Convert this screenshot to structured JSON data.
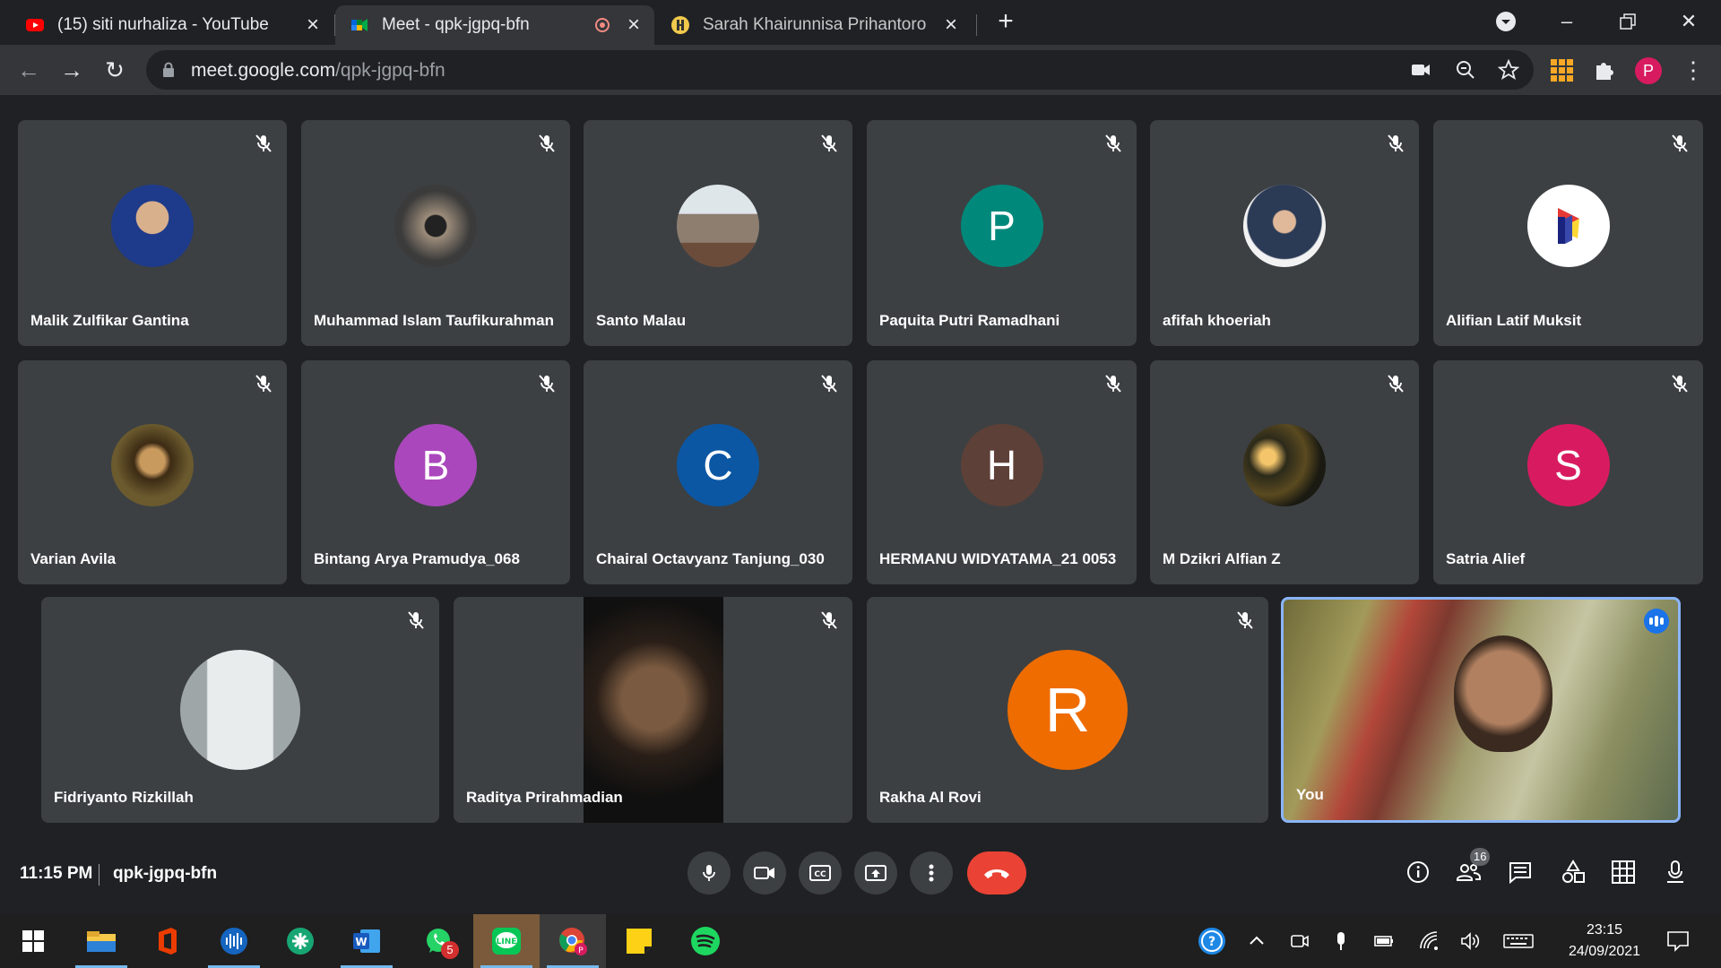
{
  "browser": {
    "tabs": [
      {
        "title": "(15) siti nurhaliza - YouTube",
        "favicon": "youtube-icon"
      },
      {
        "title": "Meet - qpk-jgpq-bfn",
        "favicon": "google-meet-icon",
        "recording": true
      },
      {
        "title": "Sarah Khairunnisa Prihantoro - Pi",
        "favicon": "site-icon"
      }
    ],
    "url_host": "meet.google.com",
    "url_path": "/qpk-jgpq-bfn",
    "profile_initial": "P"
  },
  "meet": {
    "participants": [
      {
        "name": "Malik Zulfikar Gantina",
        "avatar": "photo",
        "color": "#1e3a8a"
      },
      {
        "name": "Muhammad Islam Taufikurahman",
        "avatar": "photo",
        "color": "#3b3b3b"
      },
      {
        "name": "Santo Malau",
        "avatar": "photo",
        "color": "#8d7e70"
      },
      {
        "name": "Paquita Putri Ramadhani",
        "initial": "P",
        "color": "#00897b"
      },
      {
        "name": "afifah khoeriah",
        "avatar": "photo",
        "color": "#2b3a55"
      },
      {
        "name": "Alifian Latif Muksit",
        "avatar": "logo",
        "color": "#ffffff"
      },
      {
        "name": "Varian Avila",
        "avatar": "photo",
        "color": "#5a4a2a"
      },
      {
        "name": "Bintang Arya Pramudya_068",
        "initial": "B",
        "color": "#ab47bc"
      },
      {
        "name": "Chairal Octavyanz Tanjung_030",
        "initial": "C",
        "color": "#0b57a4"
      },
      {
        "name": "HERMANU WIDYATAMA_21 0053",
        "initial": "H",
        "color": "#5d4037"
      },
      {
        "name": "M Dzikri Alfian Z",
        "avatar": "photo",
        "color": "#2c2a1a"
      },
      {
        "name": "Satria Alief",
        "initial": "S",
        "color": "#d81b60"
      },
      {
        "name": "Fidriyanto Rizkillah",
        "avatar": "photo",
        "color": "#c7cccc"
      },
      {
        "name": "Raditya Prirahmadian",
        "avatar": "video",
        "color": "#111111"
      },
      {
        "name": "Rakha Al Rovi",
        "initial": "R",
        "color": "#ef6c00"
      },
      {
        "name": "You",
        "avatar": "video",
        "color": "#8f8a58"
      }
    ],
    "time": "11:15 PM",
    "meeting_code": "qpk-jgpq-bfn",
    "people_count": "16"
  },
  "taskbar": {
    "apps": [
      "start-icon",
      "file-explorer-icon",
      "office-icon",
      "audio-app-icon",
      "green-app-icon",
      "word-icon",
      "whatsapp-icon",
      "line-icon",
      "chrome-icon",
      "sticky-notes-icon",
      "spotify-icon"
    ],
    "whatsapp_badge": "5",
    "clock_time": "23:15",
    "clock_date": "24/09/2021"
  }
}
